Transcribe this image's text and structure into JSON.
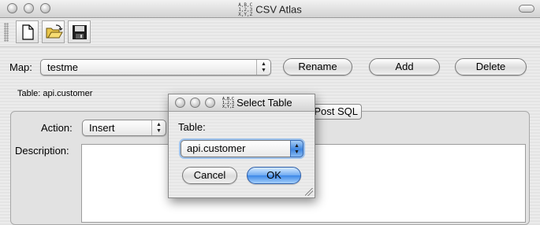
{
  "window": {
    "title": "CSV Atlas",
    "app_icon_text": [
      "A,B,C",
      "1,2,3",
      "X,Y,Z"
    ]
  },
  "toolbar": {
    "buttons": [
      "new-file-icon",
      "open-folder-icon",
      "save-disk-icon"
    ]
  },
  "map": {
    "label": "Map:",
    "selected": "testme",
    "rename_label": "Rename",
    "add_label": "Add",
    "delete_label": "Delete"
  },
  "table_info": "Table: api.customer",
  "panel": {
    "tab_partial_label": "Post SQL",
    "action_label": "Action:",
    "action_selected": "Insert",
    "description_label": "Description:"
  },
  "dialog": {
    "title": "Select Table",
    "table_label": "Table:",
    "table_selected": "api.customer",
    "cancel_label": "Cancel",
    "ok_label": "OK"
  },
  "colors": {
    "accent": "#3d88e8",
    "focus_ring": "#9cc1ec"
  }
}
